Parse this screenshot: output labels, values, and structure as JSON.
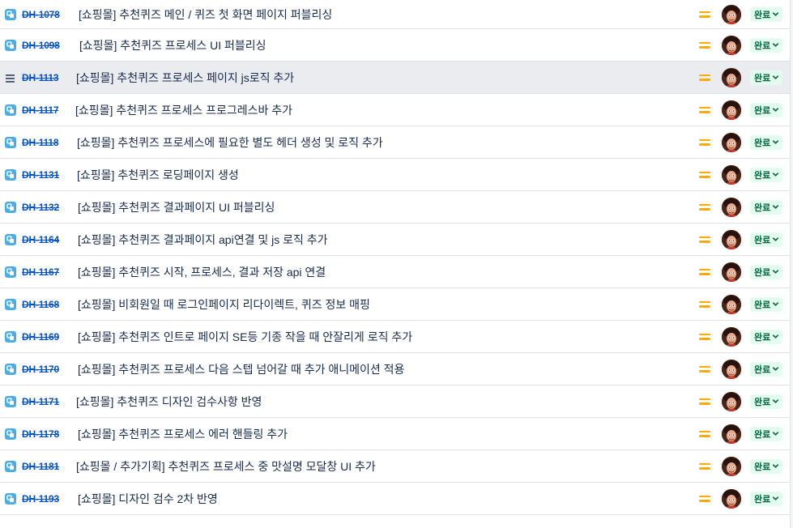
{
  "issues": [
    {
      "key": "DH-1078",
      "summary": "[쇼핑몰] 추천퀴즈 메인 / 퀴즈 첫 화면 페이지 퍼블리싱",
      "status": "완료",
      "type_icon": "subtask-icon",
      "priority": "medium",
      "assignee": "avatar"
    },
    {
      "key": "DH-1098",
      "summary": "[쇼핑몰] 추천퀴즈 프로세스 UI 퍼블리싱",
      "status": "완료",
      "type_icon": "subtask-icon",
      "priority": "medium",
      "assignee": "avatar"
    },
    {
      "key": "DH-1113",
      "summary": "[쇼핑몰] 추천퀴즈 프로세스 페이지 js로직 추가",
      "status": "완료",
      "type_icon": "drag-handle-icon",
      "priority": "medium",
      "assignee": "avatar"
    },
    {
      "key": "DH-1117",
      "summary": "[쇼핑몰] 추천퀴즈 프로세스 프로그레스바 추가",
      "status": "완료",
      "type_icon": "subtask-icon",
      "priority": "medium",
      "assignee": "avatar"
    },
    {
      "key": "DH-1118",
      "summary": "[쇼핑몰] 추천퀴즈 프로세스에 필요한 별도 헤더 생성 및 로직 추가",
      "status": "완료",
      "type_icon": "subtask-icon",
      "priority": "medium",
      "assignee": "avatar"
    },
    {
      "key": "DH-1131",
      "summary": "[쇼핑몰] 추천퀴즈 로딩페이지 생성",
      "status": "완료",
      "type_icon": "subtask-icon",
      "priority": "medium",
      "assignee": "avatar"
    },
    {
      "key": "DH-1132",
      "summary": "[쇼핑몰] 추천퀴즈 결과페이지 UI 퍼블리싱",
      "status": "완료",
      "type_icon": "subtask-icon",
      "priority": "medium",
      "assignee": "avatar"
    },
    {
      "key": "DH-1164",
      "summary": "[쇼핑몰] 추천퀴즈 결과페이지 api연결 및 js 로직 추가",
      "status": "완료",
      "type_icon": "subtask-icon",
      "priority": "medium",
      "assignee": "avatar"
    },
    {
      "key": "DH-1167",
      "summary": "[쇼핑몰] 추천퀴즈 시작, 프로세스, 결과 저장 api 연결",
      "status": "완료",
      "type_icon": "subtask-icon",
      "priority": "medium",
      "assignee": "avatar"
    },
    {
      "key": "DH-1168",
      "summary": "[쇼핑몰] 비회원일 때 로그인페이지 리다이렉트, 퀴즈 정보 매핑",
      "status": "완료",
      "type_icon": "subtask-icon",
      "priority": "medium",
      "assignee": "avatar"
    },
    {
      "key": "DH-1169",
      "summary": "[쇼핑몰] 추천퀴즈 인트로 페이지 SE등 기종 작을 때 안잘리게 로직 추가",
      "status": "완료",
      "type_icon": "subtask-icon",
      "priority": "medium",
      "assignee": "avatar"
    },
    {
      "key": "DH-1170",
      "summary": "[쇼핑몰] 추천퀴즈 프로세스 다음 스텝 넘어갈 때 추가 애니메이션 적용",
      "status": "완료",
      "type_icon": "subtask-icon",
      "priority": "medium",
      "assignee": "avatar"
    },
    {
      "key": "DH-1171",
      "summary": "[쇼핑몰] 추천퀴즈 디자인 검수사항 반영",
      "status": "완료",
      "type_icon": "subtask-icon",
      "priority": "medium",
      "assignee": "avatar"
    },
    {
      "key": "DH-1178",
      "summary": "[쇼핑몰] 추천퀴즈 프로세스 에러 핸들링 추가",
      "status": "완료",
      "type_icon": "subtask-icon",
      "priority": "medium",
      "assignee": "avatar"
    },
    {
      "key": "DH-1181",
      "summary": "[쇼핑몰 / 추가기획] 추천퀴즈 프로세스 중 맛설명 모달창 UI 추가",
      "status": "완료",
      "type_icon": "subtask-icon",
      "priority": "medium",
      "assignee": "avatar"
    },
    {
      "key": "DH-1193",
      "summary": "[쇼핑몰] 디자인 검수 2차 반영",
      "status": "완료",
      "type_icon": "subtask-icon",
      "priority": "medium",
      "assignee": "avatar"
    }
  ],
  "colors": {
    "key_link": "#0052cc",
    "priority_medium": "#ffab00",
    "status_done_bg": "#e3fcef",
    "status_done_text": "#006644",
    "subtask_icon": "#4bade8",
    "hover_row": "#ebecf0"
  }
}
